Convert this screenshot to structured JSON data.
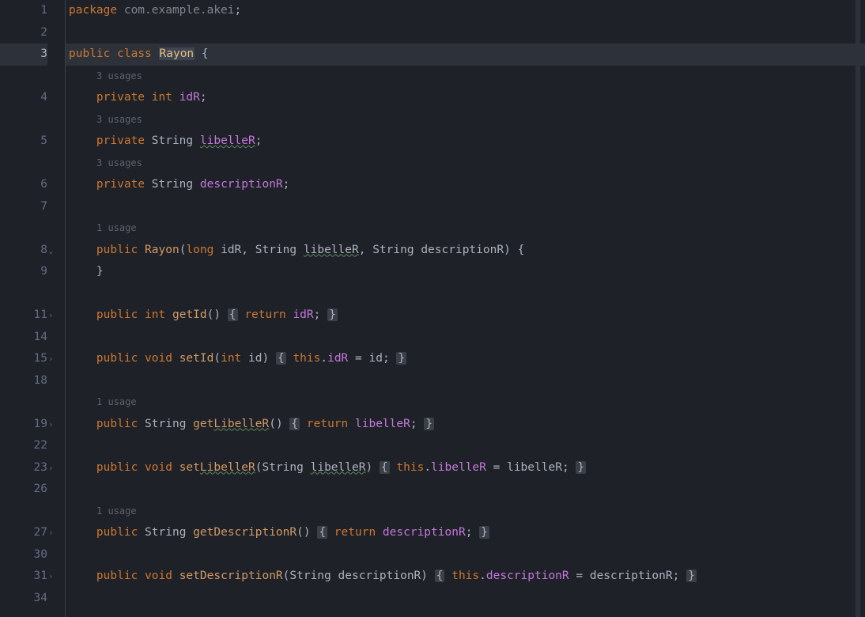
{
  "hints": {
    "usages3": "3 usages",
    "usage1": "1 usage"
  },
  "code": {
    "package_kw": "package",
    "package_name": "com.example.akei",
    "public": "public",
    "class": "class",
    "className": "Rayon",
    "private": "private",
    "int": "int",
    "long": "long",
    "void": "void",
    "String": "String",
    "idR": "idR",
    "libelleR": "libelleR",
    "descriptionR": "descriptionR",
    "this": "this",
    "return": "return",
    "getId": "getId",
    "setId": "setId",
    "id": "id",
    "getLibelleR_prefix": "get",
    "LibelleR": "LibelleR",
    "setLibelleR_prefix": "set",
    "getDescriptionR": "getDescriptionR",
    "setDescriptionR": "setDescriptionR"
  },
  "gutter": {
    "1": "1",
    "2": "2",
    "3": "3",
    "4": "4",
    "5": "5",
    "6": "6",
    "7": "7",
    "8": "8",
    "9": "9",
    "11": "11",
    "14": "14",
    "15": "15",
    "18": "18",
    "19": "19",
    "22": "22",
    "23": "23",
    "26": "26",
    "27": "27",
    "30": "30",
    "31": "31",
    "34": "34"
  }
}
